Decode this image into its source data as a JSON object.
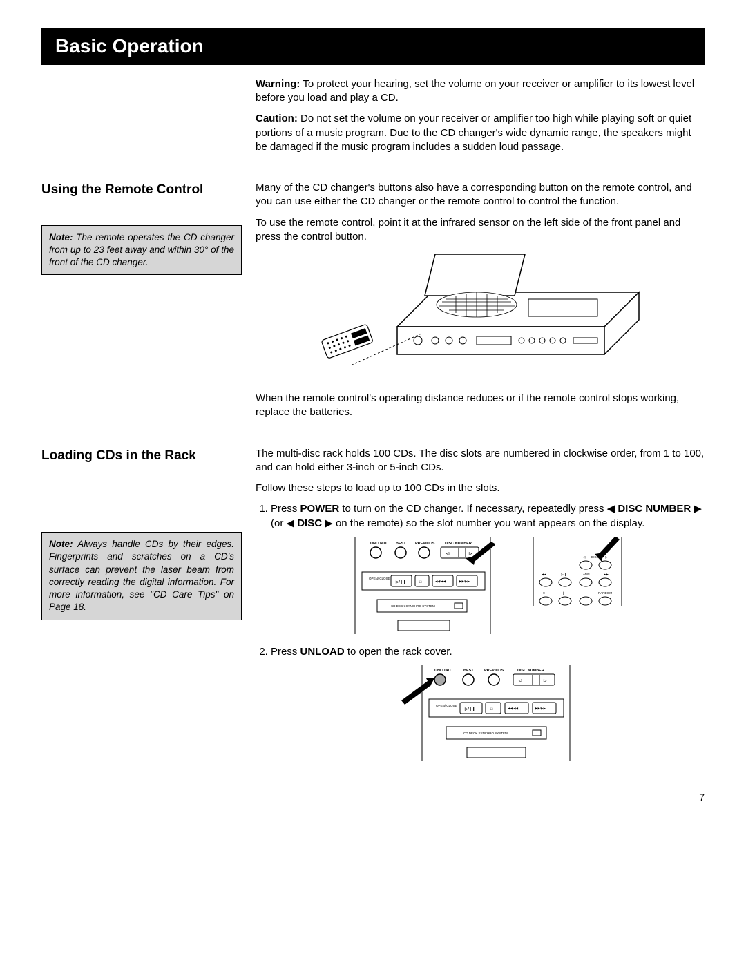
{
  "title": "Basic Operation",
  "warning_label": "Warning:",
  "warning_text": " To protect your hearing, set the volume on your receiver or amplifier to its lowest level before you load and play a CD.",
  "caution_label": "Caution:",
  "caution_text": " Do not set the volume on your receiver or amplifier too high while playing soft or quiet portions of a music program. Due to the CD changer's wide dynamic range, the speakers might be damaged if the music program includes a sudden loud passage.",
  "remote": {
    "heading": "Using the Remote Control",
    "note_label": "Note:",
    "note_text": " The remote operates the CD changer from up to 23 feet away and within 30° of the front of the CD changer.",
    "p1": "Many of the CD changer's buttons also have a corresponding button on the remote control, and you can use either the CD changer or the remote control to control the function.",
    "p2": "To use the remote control, point it at the infrared sensor on the left side of the front panel and press the control button.",
    "p3": "When the remote control's operating distance reduces or if the remote control stops working, replace the batteries."
  },
  "loading": {
    "heading": "Loading CDs in the Rack",
    "note_label": "Note:",
    "note_text": " Always handle CDs by their edges. Fingerprints and scratches on a CD's surface can prevent the laser beam from correctly reading the digital information. For more information, see \"CD Care Tips\" on Page 18.",
    "p1": "The multi-disc rack holds 100 CDs. The disc slots are numbered in clockwise order, from 1 to 100, and can hold either 3-inch or 5-inch CDs.",
    "p2": "Follow these steps to load up to 100 CDs in the slots.",
    "step1_a": "Press ",
    "step1_power": "POWER",
    "step1_b": " to turn on the CD changer. If necessary, repeatedly press ",
    "step1_dn": "DISC NUMBER",
    "step1_c": " (or ",
    "step1_disc": "DISC",
    "step1_d": " on the remote) so the slot number you want appears on the display.",
    "step2_a": "Press ",
    "step2_unload": "UNLOAD",
    "step2_b": " to open the rack cover."
  },
  "panel": {
    "unload": "UNLOAD",
    "best": "BEST",
    "previous": "PREVIOUS",
    "disc_number": "DISC NUMBER",
    "open_close": "OPEN/\nCLOSE",
    "synchro": "CD DECK SYNCHRO SYSTEM",
    "disc": "DISC",
    "ams": "AMS",
    "random": "RANDOM"
  },
  "page": "7"
}
